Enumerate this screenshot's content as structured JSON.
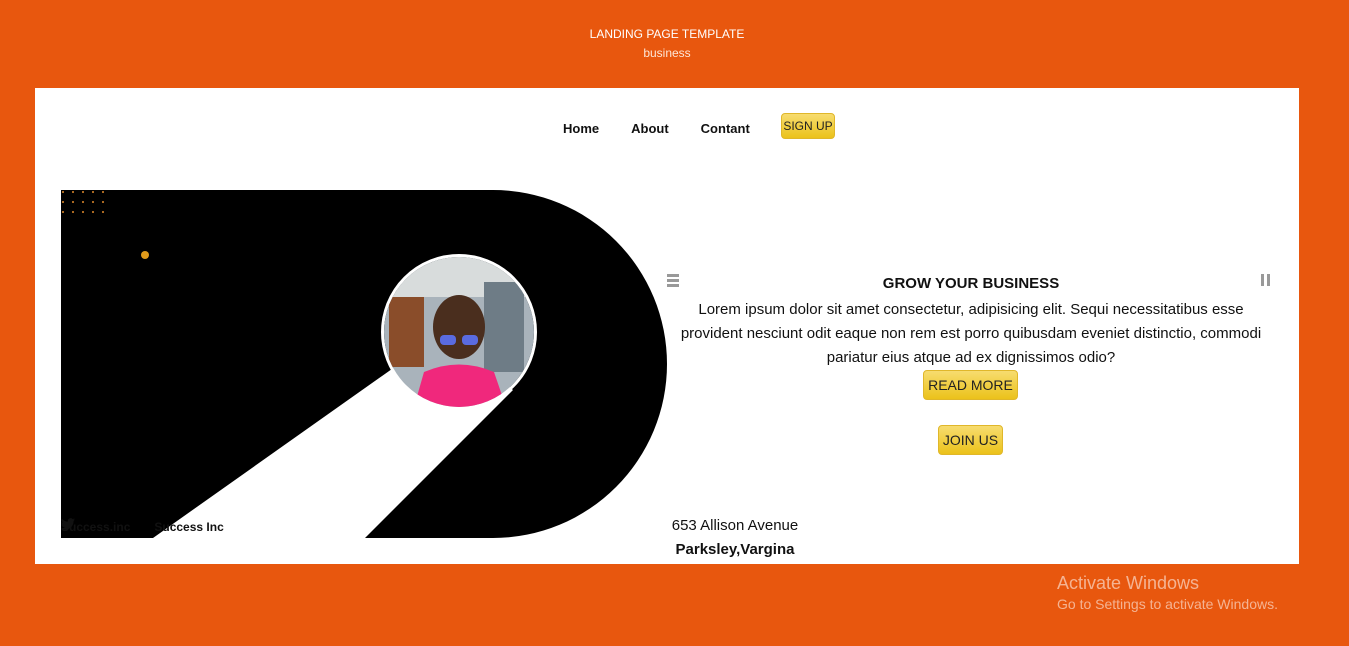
{
  "page_header": {
    "title": "LANDING PAGE TEMPLATE",
    "subtitle": "business"
  },
  "nav": {
    "home": "Home",
    "about": "About",
    "contact": "Contant",
    "signup": "SIGN UP"
  },
  "hero": {
    "social_instagram": "Success.inc",
    "social_twitter": "Success Inc",
    "icons": [
      "twitter-icon"
    ]
  },
  "content": {
    "title": "GROW YOUR BUSINESS",
    "body": "Lorem ipsum dolor sit amet consectetur, adipisicing elit. Sequi necessitatibus esse provident nesciunt odit eaque non rem est porro quibusdam eveniet distinctio, commodi pariatur eius atque ad ex dignissimos odio?",
    "read_more": "READ MORE",
    "join_us": "JOIN US"
  },
  "address": {
    "street": "653 Allison Avenue",
    "city": "Parksley,Vargina"
  },
  "watermark": {
    "title": "Activate Windows",
    "subtitle": "Go to Settings to activate Windows."
  },
  "colors": {
    "background": "#e8570e",
    "accent": "#f2cf45",
    "hero": "#000000",
    "dots": "#e08a2a"
  }
}
